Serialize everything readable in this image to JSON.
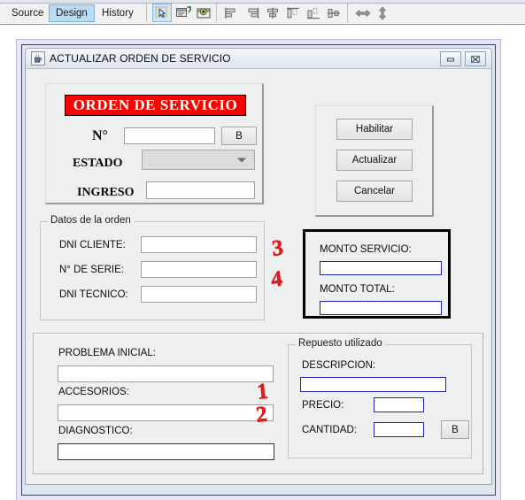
{
  "ide": {
    "tabs": [
      {
        "id": "source",
        "label": "Source",
        "active": false
      },
      {
        "id": "design",
        "label": "Design",
        "active": true
      },
      {
        "id": "history",
        "label": "History",
        "active": false
      }
    ],
    "toolbar_icons": [
      "selection-tool-icon",
      "preview-design-icon",
      "preview-window-icon",
      "align-left-icon",
      "align-right-icon",
      "align-center-horizontal-icon",
      "align-top-icon",
      "align-bottom-icon",
      "align-center-vertical-icon",
      "resize-horizontal-icon",
      "resize-vertical-icon"
    ]
  },
  "window": {
    "title": "ACTUALIZAR ORDEN DE SERVICIO",
    "app_icon": "java-coffee-cup-icon",
    "minimize_label": "—",
    "close_label": "✖"
  },
  "header_panel": {
    "banner": "ORDEN DE SERVICIO",
    "banner_bg": "#ff0000",
    "banner_fg": "#ffffff",
    "numero_label": "N°",
    "numero_value": "",
    "buscar_label": "B",
    "estado_label": "ESTADO",
    "estado_value": "",
    "ingreso_label": "INGRESO",
    "ingreso_value": ""
  },
  "actions": {
    "habilitar": "Habilitar",
    "actualizar": "Actualizar",
    "cancelar": "Cancelar"
  },
  "datos_orden": {
    "title": "Datos de la orden",
    "fields": [
      {
        "label": "DNI CLIENTE:",
        "value": ""
      },
      {
        "label": "N° DE SERIE:",
        "value": ""
      },
      {
        "label": "DNI TECNICO:",
        "value": ""
      }
    ]
  },
  "montos": {
    "servicio_label": "MONTO SERVICIO:",
    "servicio_value": "",
    "total_label": "MONTO TOTAL:",
    "total_value": "",
    "border_color": "#000000",
    "field_border_color": "#2323b8"
  },
  "detalle": {
    "problema_label": "PROBLEMA INICIAL:",
    "problema_value": "",
    "accesorios_label": "ACCESORIOS:",
    "accesorios_value": "",
    "diagnostico_label": "DIAGNOSTICO:",
    "diagnostico_value": ""
  },
  "repuesto": {
    "title": "Repuesto utilizado",
    "descripcion_label": "DESCRIPCION:",
    "descripcion_value": "",
    "precio_label": "PRECIO:",
    "precio_value": "",
    "cantidad_label": "CANTIDAD:",
    "cantidad_value": "",
    "buscar_label": "B"
  },
  "annotations": {
    "color": "#e01b1b",
    "marks": [
      {
        "text": "1",
        "target": "precio-field"
      },
      {
        "text": "2",
        "target": "cantidad-field"
      },
      {
        "text": "3",
        "target": "monto-servicio-field"
      },
      {
        "text": "4",
        "target": "monto-total-field"
      }
    ]
  }
}
